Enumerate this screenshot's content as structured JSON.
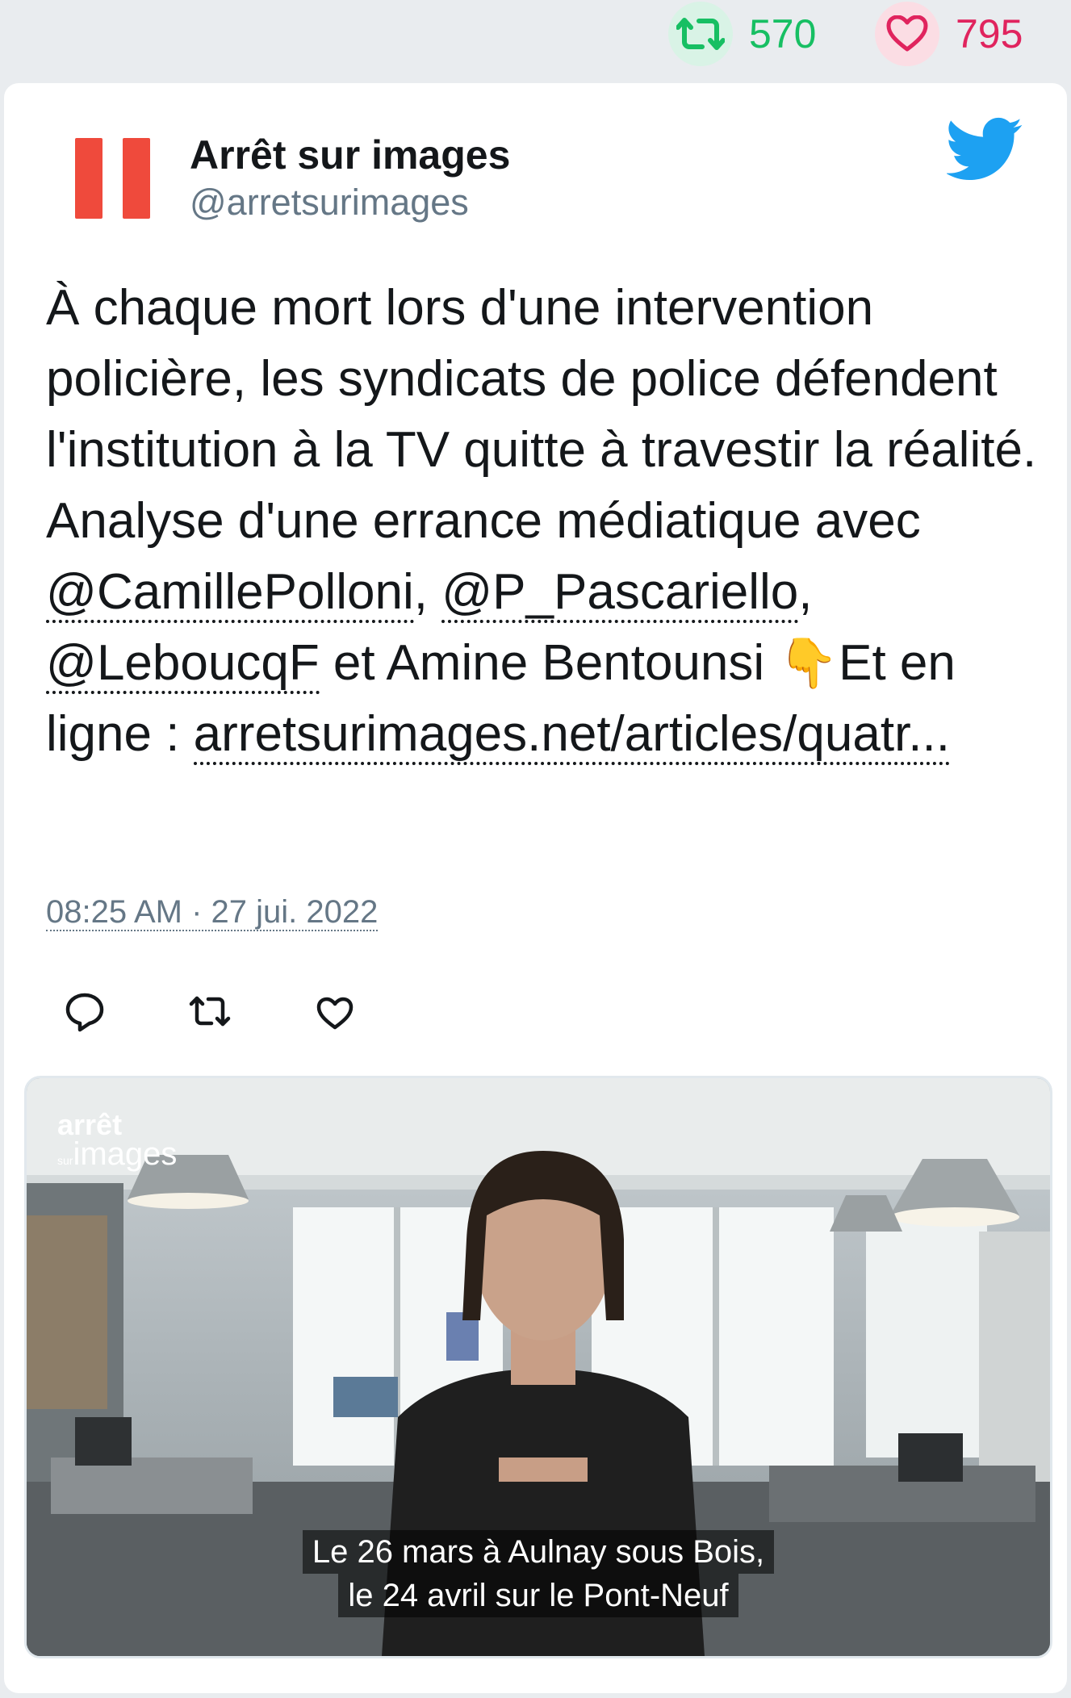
{
  "stats": {
    "retweet_count": "570",
    "like_count": "795"
  },
  "colors": {
    "retweet": "#17bf63",
    "like": "#e0245e",
    "twitter_blue": "#1da1f2",
    "logo_red": "#ef4a3c"
  },
  "tweet": {
    "name": "Arrêt sur images",
    "handle": "@arretsurimages",
    "text_part1": "À chaque mort lors d'une intervention policière, les syndicats de police défendent l'institution à la TV quitte à travestir la réalité. Analyse d'une errance médiatique avec ",
    "mention1": "@CamillePolloni",
    "sep1": ", ",
    "mention2": "@P_Pascariello",
    "sep2": ", ",
    "mention3": "@LeboucqF",
    "text_part2": " et Amine Bentounsi ",
    "emoji": "👇",
    "text_part3": "Et en ligne : ",
    "link": "arretsurimages.net/articles/quatr...",
    "timestamp": "08:25 AM · 27 jui. 2022"
  },
  "icons": {
    "retweet_stat": "retweet-icon",
    "like_stat": "heart-icon",
    "brand": "twitter-bird-icon",
    "reply_action": "reply-icon",
    "retweet_action": "retweet-icon",
    "like_action": "heart-icon"
  },
  "media": {
    "logo_top": "arrêt",
    "logo_small": "sur",
    "logo_bottom": "images",
    "caption_line1": "Le 26 mars à Aulnay sous Bois,",
    "caption_line2": "le 24 avril sur le Pont-Neuf"
  }
}
